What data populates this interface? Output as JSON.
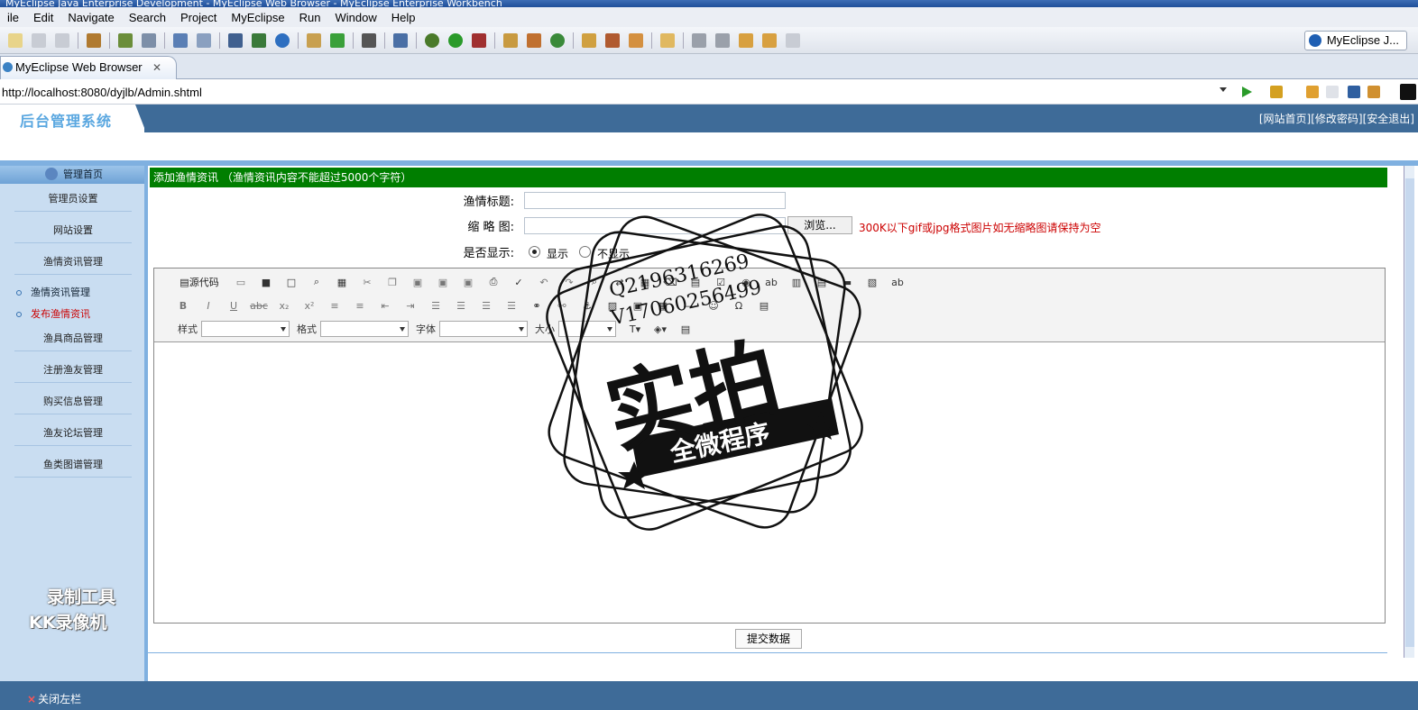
{
  "window": {
    "title": "MyEclipse Java Enterprise Development - MyEclipse Web Browser - MyEclipse Enterprise Workbench"
  },
  "menu": [
    "ile",
    "Edit",
    "Navigate",
    "Search",
    "Project",
    "MyEclipse",
    "Run",
    "Window",
    "Help"
  ],
  "perspective": {
    "label": "MyEclipse J..."
  },
  "tab": {
    "label": "MyEclipse Web Browser"
  },
  "browser": {
    "url": "http://localhost:8080/dyjlb/Admin.shtml"
  },
  "admin": {
    "logo": "后台管理系统",
    "links": [
      "[网站首页]",
      "[修改密码]",
      "[安全退出]"
    ]
  },
  "sidebar": {
    "head": "管理首页",
    "items": [
      {
        "label": "管理员设置"
      },
      {
        "label": "网站设置"
      },
      {
        "label": "渔情资讯管理"
      },
      {
        "label": "渔具商品管理"
      },
      {
        "label": "注册渔友管理"
      },
      {
        "label": "购买信息管理"
      },
      {
        "label": "渔友论坛管理"
      },
      {
        "label": "鱼类图谱管理"
      }
    ],
    "subitems": [
      {
        "label": "渔情资讯管理"
      },
      {
        "label": "发布渔情资讯"
      }
    ],
    "watermark": [
      "录制工具",
      "KK录像机"
    ]
  },
  "form": {
    "header": "添加渔情资讯 （渔情资讯内容不能超过5000个字符）",
    "title_label": "渔情标题:",
    "title_value": "",
    "thumb_label": "缩 略 图:",
    "thumb_value": "",
    "browse_label": "浏览...",
    "thumb_hint": "300K以下gif或jpg格式图片如无缩略图请保持为空",
    "show_label": "是否显示:",
    "show_yes": "显示",
    "show_no": "不显示",
    "show_selected": "显示",
    "submit_label": "提交数据"
  },
  "editor": {
    "source_label": "源代码",
    "style_label": "样式",
    "format_label": "格式",
    "font_label": "字体",
    "size_label": "大小"
  },
  "footer": {
    "close_left": "关闭左栏"
  },
  "stamp": {
    "main": "实拍",
    "sub": "全微程序",
    "contact_q": "Q2196316269",
    "contact_v": "V17060256499"
  }
}
